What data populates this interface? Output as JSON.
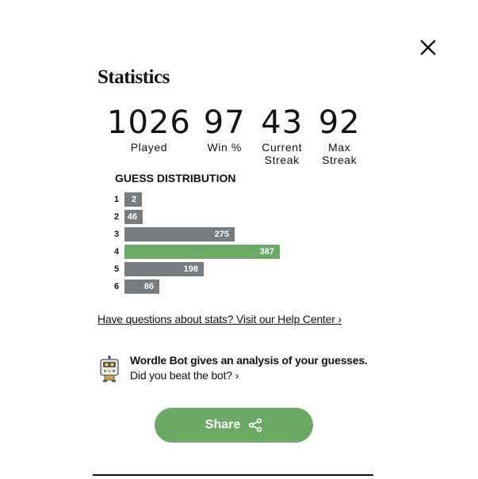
{
  "modal": {
    "title": "Statistics",
    "close_icon": "close-icon"
  },
  "stats": [
    {
      "value": "1026",
      "label": "Played"
    },
    {
      "value": "97",
      "label": "Win %"
    },
    {
      "value": "43",
      "label": "Current Streak"
    },
    {
      "value": "92",
      "label": "Max Streak"
    }
  ],
  "distribution": {
    "title": "GUESS DISTRIBUTION",
    "rows": [
      {
        "guess": "1",
        "count": 2,
        "highlight": false
      },
      {
        "guess": "2",
        "count": 46,
        "highlight": false
      },
      {
        "guess": "3",
        "count": 275,
        "highlight": false
      },
      {
        "guess": "4",
        "count": 387,
        "highlight": true
      },
      {
        "guess": "5",
        "count": 198,
        "highlight": false
      },
      {
        "guess": "6",
        "count": 86,
        "highlight": false
      }
    ]
  },
  "help": {
    "link_text": "Have questions about stats? Visit our Help Center ›"
  },
  "bot": {
    "icon": "wordle-bot-icon",
    "heading": "Wordle Bot gives an analysis of your guesses.",
    "subtext": "Did you beat the bot? ›"
  },
  "share": {
    "label": "Share",
    "icon": "share-icon"
  },
  "colors": {
    "bar_default": "#787c7e",
    "bar_highlight": "#6aaa64",
    "share_button": "#6aaa64",
    "text": "#121212"
  }
}
